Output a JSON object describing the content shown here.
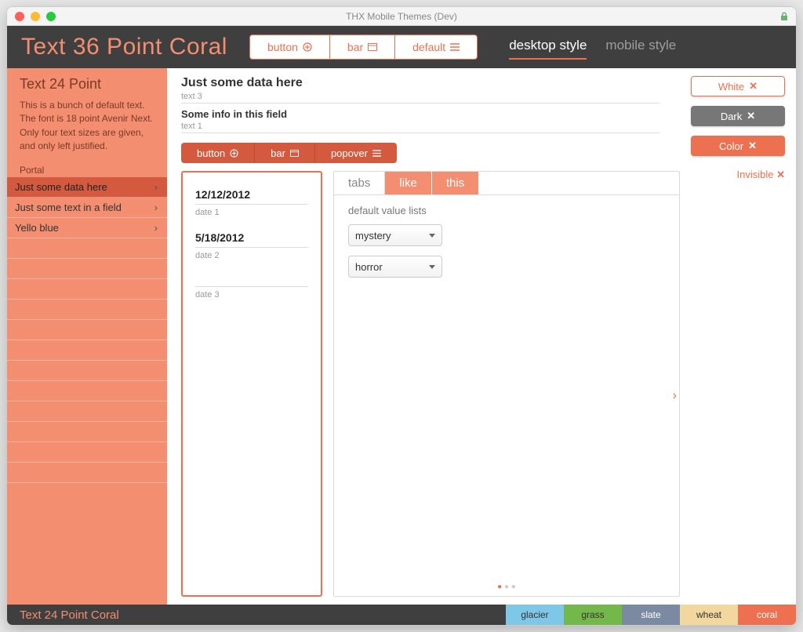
{
  "window": {
    "title": "THX Mobile Themes (Dev)"
  },
  "header": {
    "title": "Text 36 Point Coral",
    "segments": {
      "button": "button",
      "bar": "bar",
      "default": "default"
    },
    "styles": {
      "desktop": "desktop style",
      "mobile": "mobile style"
    }
  },
  "sidebar": {
    "title": "Text 24 Point",
    "body": "This is a bunch of default text. The font is 18 point Avenir Next. Only four text sizes are given, and only left justified.",
    "section": "Portal",
    "rows": [
      {
        "label": "Just some data here"
      },
      {
        "label": "Just some text in a field"
      },
      {
        "label": "Yello blue"
      }
    ]
  },
  "fields": {
    "data": {
      "value": "Just some data here",
      "label": "text 3"
    },
    "info": {
      "value": "Some info in this field",
      "label": "text 1"
    }
  },
  "orange_segments": {
    "button": "button",
    "bar": "bar",
    "popover": "popover"
  },
  "dates": [
    {
      "value": "12/12/2012",
      "label": "date 1"
    },
    {
      "value": "5/18/2012",
      "label": "date 2"
    },
    {
      "value": "",
      "label": "date 3"
    }
  ],
  "tabs": {
    "a": "tabs",
    "b": "like",
    "c": "this",
    "body_label": "default value lists"
  },
  "selects": {
    "a": "mystery",
    "b": "horror"
  },
  "pills": {
    "white": "White",
    "dark": "Dark",
    "color": "Color",
    "invisible": "Invisible"
  },
  "footer": {
    "label": "Text 24 Point Coral",
    "swatches": {
      "glacier": "glacier",
      "grass": "grass",
      "slate": "slate",
      "wheat": "wheat",
      "coral": "coral"
    }
  }
}
